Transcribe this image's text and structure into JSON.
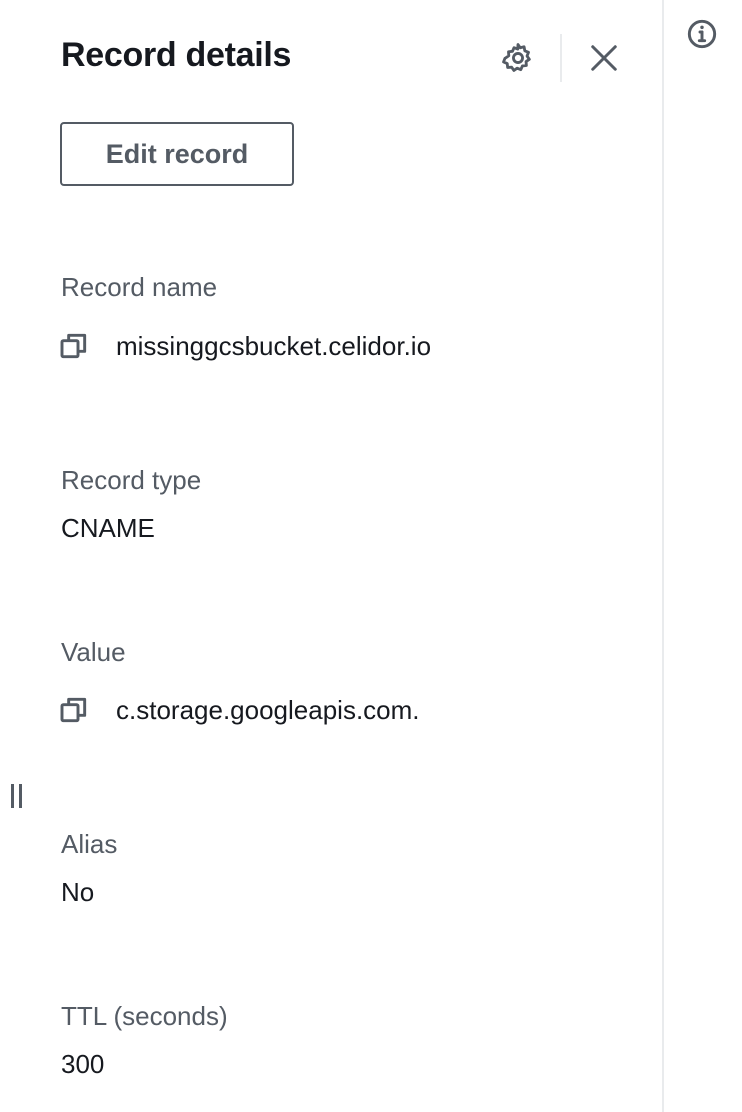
{
  "panel": {
    "title": "Record details",
    "icons": {
      "settings": "gear-icon",
      "close": "close-icon",
      "info": "info-icon",
      "copy": "copy-icon",
      "resize": "resize-handle-icon"
    },
    "edit_button_label": "Edit record"
  },
  "details": {
    "record_name": {
      "label": "Record name",
      "value": "missinggcsbucket.celidor.io"
    },
    "record_type": {
      "label": "Record type",
      "value": "CNAME"
    },
    "value": {
      "label": "Value",
      "value": "c.storage.googleapis.com."
    },
    "alias": {
      "label": "Alias",
      "value": "No"
    },
    "ttl": {
      "label": "TTL (seconds)",
      "value": "300"
    }
  },
  "colors": {
    "text_primary": "#16191f",
    "text_secondary": "#545b64",
    "border": "#e9ebed"
  }
}
